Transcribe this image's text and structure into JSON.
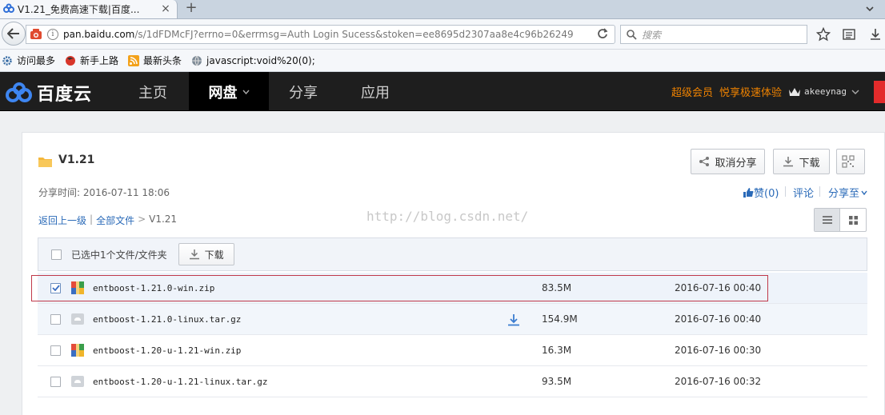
{
  "browser": {
    "tab_title": "V1.21_免费高速下载|百度...",
    "tab_close": "×",
    "new_tab": "+",
    "url_domain": "pan.baidu.com",
    "url_prefix": "",
    "url_rest": "/s/1dFDMcFJ?errno=0&errmsg=Auth Login Sucess&stoken=ee8695d2307aa8e4c96b26249",
    "reload_glyph": "C",
    "info_glyph": "i",
    "search_placeholder": "搜索"
  },
  "bookmarks": [
    {
      "label": "访问最多",
      "icon": "gear-bookmark-icon"
    },
    {
      "label": "新手上路",
      "icon": "firefox-bookmark-icon"
    },
    {
      "label": "最新头条",
      "icon": "rss-bookmark-icon"
    },
    {
      "label": "javascript:void%20(0);",
      "icon": "globe-bookmark-icon"
    }
  ],
  "site": {
    "logo_text": "百度云",
    "nav": [
      {
        "label": "主页",
        "active": false
      },
      {
        "label": "网盘",
        "active": true
      },
      {
        "label": "分享",
        "active": false
      },
      {
        "label": "应用",
        "active": false
      }
    ],
    "vip_label": "超级会员",
    "speed_label": "悦享极速体验",
    "username": "akeeynag",
    "colors": {
      "header_bg": "#1e1e1e",
      "vip": "#f08300",
      "link": "#2a6ab8"
    }
  },
  "folder": {
    "name": "V1.21",
    "share_time": "分享时间: 2016-07-11 18:06",
    "cancel_share": "取消分享",
    "download": "下载",
    "like": "赞(0)",
    "comment": "评论",
    "share_to": "分享至",
    "breadcrumb": {
      "back": "返回上一级",
      "sep1": "|",
      "all": "全部文件",
      "sep2": ">",
      "current": "V1.21"
    },
    "watermark": "http://blog.csdn.net/"
  },
  "list": {
    "selected_text": "已选中1个文件/文件夹",
    "download": "下载",
    "files": [
      {
        "name": "entboost-1.21.0-win.zip",
        "size": "83.5M",
        "date": "2016-07-16 00:40",
        "checked": true,
        "type": "zip"
      },
      {
        "name": "entboost-1.21.0-linux.tar.gz",
        "size": "154.9M",
        "date": "2016-07-16 00:40",
        "checked": false,
        "type": "gz"
      },
      {
        "name": "entboost-1.20-u-1.21-win.zip",
        "size": "16.3M",
        "date": "2016-07-16 00:30",
        "checked": false,
        "type": "zip"
      },
      {
        "name": "entboost-1.20-u-1.21-linux.tar.gz",
        "size": "93.5M",
        "date": "2016-07-16 00:32",
        "checked": false,
        "type": "gz"
      }
    ]
  }
}
